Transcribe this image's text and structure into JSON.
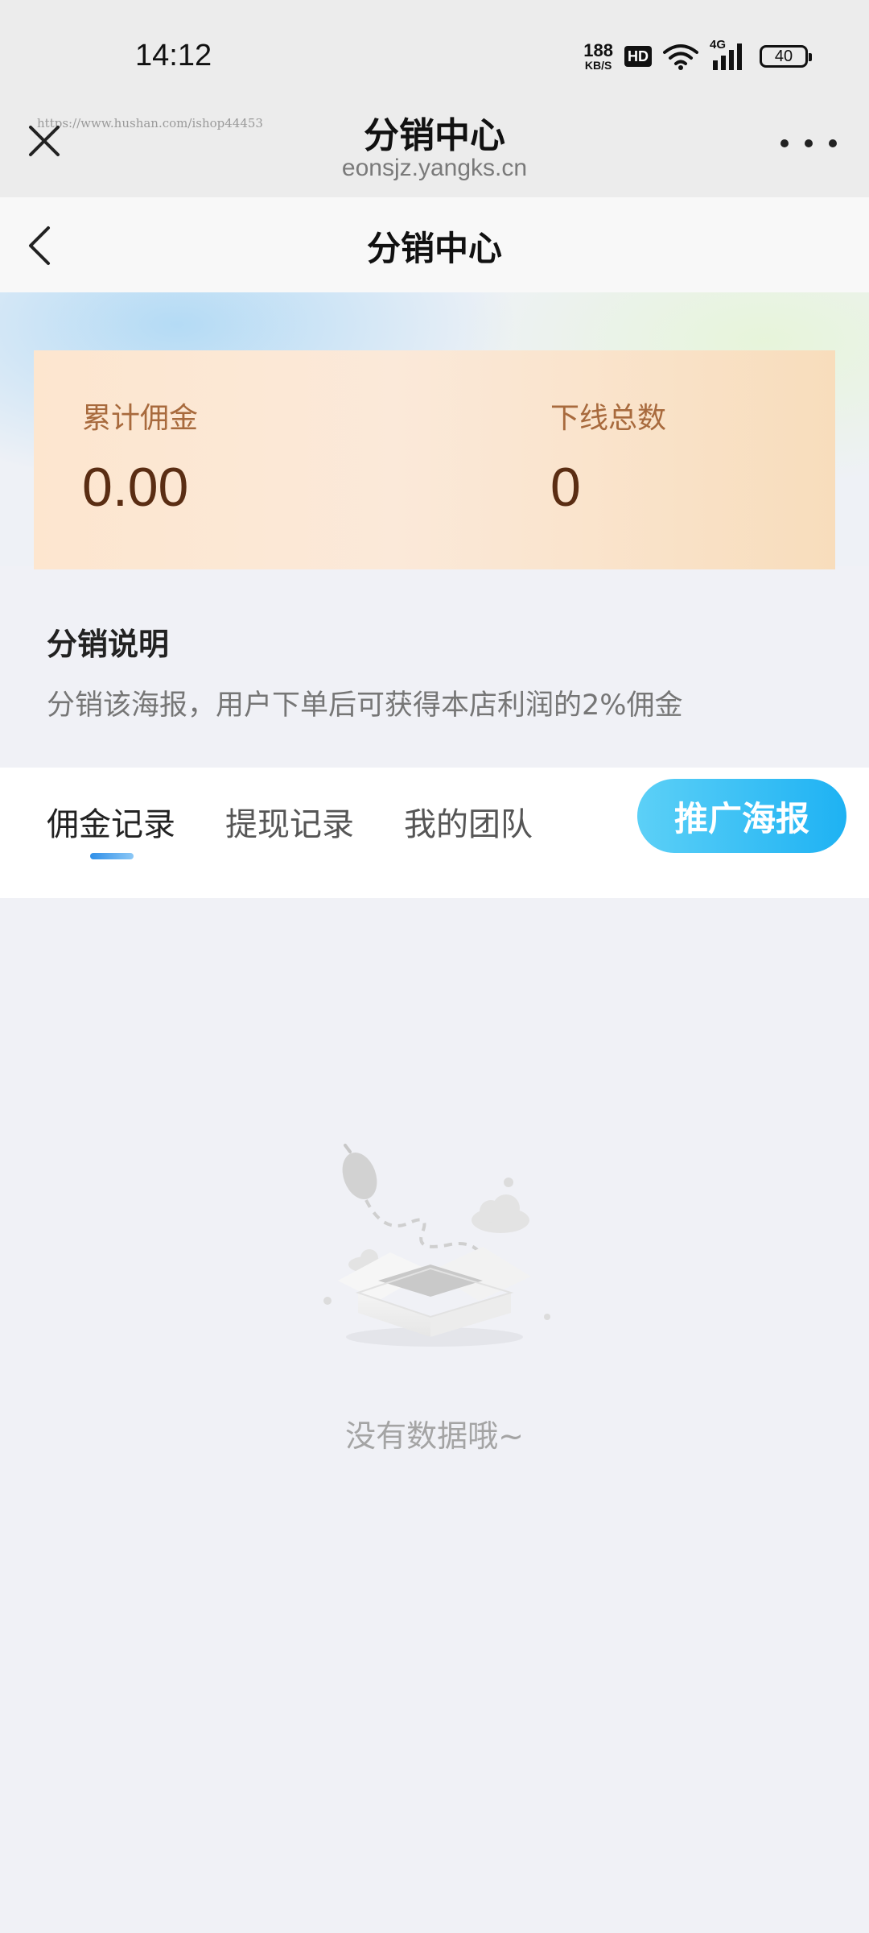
{
  "status_bar": {
    "time": "14:12",
    "net_speed_value": "188",
    "net_speed_unit": "KB/S",
    "hd_label": "HD",
    "network_label": "4G",
    "battery": "40"
  },
  "browser": {
    "watermark": "https://www.hushan.com/ishop44453",
    "title": "分销中心",
    "url": "eonsjz.yangks.cn"
  },
  "page": {
    "title": "分销中心"
  },
  "stats": {
    "commission_label": "累计佣金",
    "commission_value": "0.00",
    "downline_label": "下线总数",
    "downline_value": "0"
  },
  "description": {
    "title": "分销说明",
    "text": "分销该海报，用户下单后可获得本店利润的2%佣金"
  },
  "tabs": [
    {
      "label": "佣金记录",
      "active": true
    },
    {
      "label": "提现记录",
      "active": false
    },
    {
      "label": "我的团队",
      "active": false
    }
  ],
  "promo_button": "推广海报",
  "empty_state": {
    "text": "没有数据哦~"
  },
  "colors": {
    "accent": "#1eb2f3",
    "card_text": "#5a2d13",
    "card_label": "#a86a3d"
  }
}
